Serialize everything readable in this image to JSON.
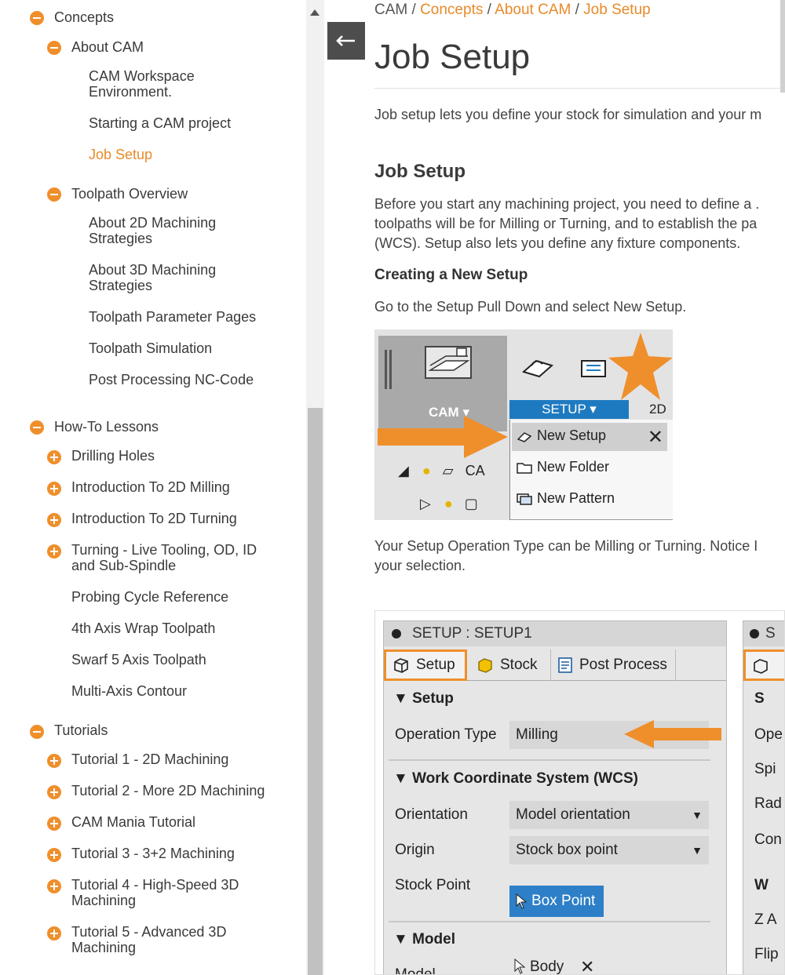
{
  "sidebar": {
    "concepts": "Concepts",
    "about_cam": "About CAM",
    "cam_workspace": "CAM Workspace Environment.",
    "starting_project": "Starting a CAM project",
    "job_setup": "Job Setup",
    "toolpath_overview": "Toolpath Overview",
    "about_2d": "About 2D Machining Strategies",
    "about_3d": "About 3D Machining Strategies",
    "toolpath_param": "Toolpath Parameter Pages",
    "toolpath_sim": "Toolpath Simulation",
    "post_processing": "Post Processing NC-Code",
    "howto": "How-To Lessons",
    "drilling": "Drilling Holes",
    "intro_2d_milling": "Introduction To 2D Milling",
    "intro_2d_turning": "Introduction To 2D Turning",
    "turning_live": "Turning - Live Tooling, OD, ID and Sub-Spindle",
    "probing": "Probing Cycle Reference",
    "fourth_axis": "4th Axis Wrap Toolpath",
    "swarf": "Swarf 5 Axis Toolpath",
    "multi_axis": "Multi-Axis Contour",
    "tutorials": "Tutorials",
    "tut1": "Tutorial 1 - 2D Machining",
    "tut2": "Tutorial 2 - More 2D Machining",
    "cam_mania": "CAM Mania Tutorial",
    "tut3": "Tutorial 3 - 3+2 Machining",
    "tut4": "Tutorial 4 - High-Speed 3D Machining",
    "tut5": "Tutorial 5 - Advanced 3D Machining"
  },
  "breadcrumb": {
    "root": "CAM",
    "sep": " / ",
    "concepts": "Concepts",
    "about_cam": "About CAM",
    "job_setup": "Job Setup"
  },
  "page": {
    "title": "Job Setup",
    "intro": "Job setup lets you define your stock for simulation and your m",
    "section_heading": "Job Setup",
    "para1_line1": "Before you start any machining project, you need to define a .",
    "para1_line2": "toolpaths will be for Milling or Turning, and to establish the pa",
    "para1_line3": "(WCS). Setup also lets you define any fixture components.",
    "subheading": "Creating a New Setup",
    "para2": "Go to the Setup Pull Down and select New Setup.",
    "para3_line1": "Your Setup Operation Type can be Milling or Turning. Notice I",
    "para3_line2": "your selection."
  },
  "menu_shot": {
    "cam": "CAM ▾",
    "setup": "SETUP ▾",
    "twod": "2D",
    "new_setup": "New Setup",
    "new_folder": "New Folder",
    "new_pattern": "New Pattern",
    "close": "✕",
    "tree_text": "CA"
  },
  "panel_shot": {
    "header": "SETUP : SETUP1",
    "tab_setup": "Setup",
    "tab_stock": "Stock",
    "tab_post": "Post Process",
    "sec_setup": "Setup",
    "operation_type_label": "Operation Type",
    "operation_type_value": "Milling",
    "sec_wcs": "Work Coordinate System (WCS)",
    "orientation_label": "Orientation",
    "orientation_value": "Model orientation",
    "origin_label": "Origin",
    "origin_value": "Stock box point",
    "stock_point_label": "Stock Point",
    "stock_point_value": "Box Point",
    "sec_model": "Model",
    "model_label": "Model",
    "model_value": "Body",
    "model_clear": "✕",
    "second_header": "S",
    "second_sec1": "S",
    "second_ope": "Ope",
    "second_spi": "Spi",
    "second_rad": "Rad",
    "second_con": "Con",
    "second_sec2": "W",
    "second_za": "Z A",
    "second_flip": "Flip"
  },
  "colors": {
    "accent_orange": "#ef8f2c",
    "link_orange": "#e88a2a",
    "setup_blue": "#1e7ac0"
  }
}
